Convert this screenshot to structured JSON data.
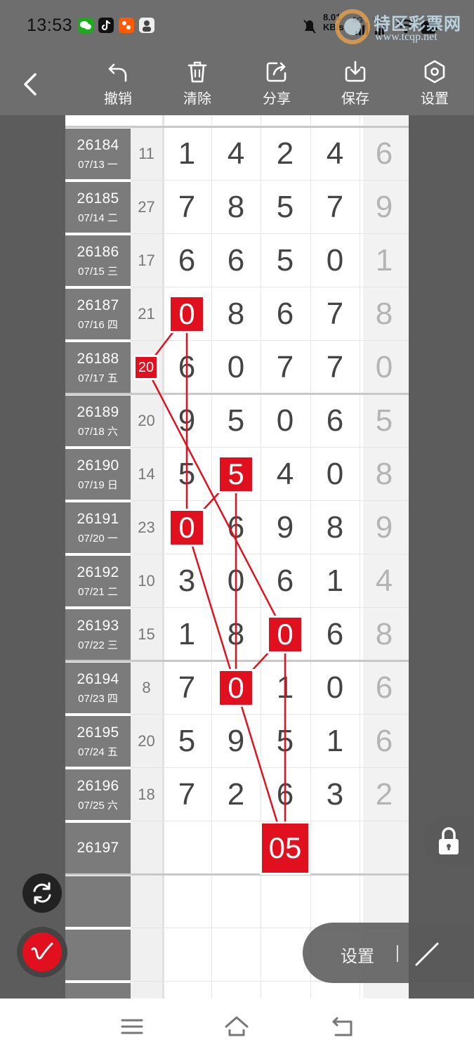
{
  "status_bar": {
    "time": "13:53",
    "speed": "8.01",
    "speed_unit": "KB/s",
    "network_a": "5G",
    "network_b": "5G",
    "icons": [
      "wechat-icon",
      "tiktok-icon",
      "taobao-icon",
      "avatar-app-icon",
      "mute-icon",
      "signal-icon",
      "wifi-icon",
      "battery-icon"
    ]
  },
  "watermark": {
    "title": "特区彩票网",
    "url": "www.tcqp.net"
  },
  "toolbar": {
    "back_icon": "chevron-left-icon",
    "items": [
      {
        "label": "撤销",
        "icon": "undo-icon"
      },
      {
        "label": "清除",
        "icon": "trash-icon"
      },
      {
        "label": "分享",
        "icon": "share-icon"
      },
      {
        "label": "保存",
        "icon": "download-icon"
      },
      {
        "label": "设置",
        "icon": "hexagon-settings-icon"
      }
    ]
  },
  "rows": [
    {
      "issue": "26184",
      "date": "07/13 一",
      "sum": "11",
      "digits": [
        "1",
        "4",
        "2",
        "4",
        "6"
      ]
    },
    {
      "issue": "26185",
      "date": "07/14 二",
      "sum": "27",
      "digits": [
        "7",
        "8",
        "5",
        "7",
        "9"
      ]
    },
    {
      "issue": "26186",
      "date": "07/15 三",
      "sum": "17",
      "digits": [
        "6",
        "6",
        "5",
        "0",
        "1"
      ]
    },
    {
      "issue": "26187",
      "date": "07/16 四",
      "sum": "21",
      "digits": [
        "0",
        "8",
        "6",
        "7",
        "8"
      ]
    },
    {
      "issue": "26188",
      "date": "07/17 五",
      "sum": "20",
      "digits": [
        "6",
        "0",
        "7",
        "7",
        "0"
      ]
    },
    {
      "issue": "26189",
      "date": "07/18 六",
      "sum": "20",
      "digits": [
        "9",
        "5",
        "0",
        "6",
        "5"
      ]
    },
    {
      "issue": "26190",
      "date": "07/19 日",
      "sum": "14",
      "digits": [
        "5",
        "5",
        "4",
        "0",
        "8"
      ]
    },
    {
      "issue": "26191",
      "date": "07/20 一",
      "sum": "23",
      "digits": [
        "0",
        "6",
        "9",
        "8",
        "9"
      ]
    },
    {
      "issue": "26192",
      "date": "07/21 二",
      "sum": "10",
      "digits": [
        "3",
        "0",
        "6",
        "1",
        "4"
      ]
    },
    {
      "issue": "26193",
      "date": "07/22 三",
      "sum": "15",
      "digits": [
        "1",
        "8",
        "0",
        "6",
        "8"
      ]
    },
    {
      "issue": "26194",
      "date": "07/23 四",
      "sum": "8",
      "digits": [
        "7",
        "0",
        "1",
        "0",
        "6"
      ]
    },
    {
      "issue": "26195",
      "date": "07/24 五",
      "sum": "20",
      "digits": [
        "5",
        "9",
        "5",
        "1",
        "6"
      ]
    },
    {
      "issue": "26196",
      "date": "07/25 六",
      "sum": "18",
      "digits": [
        "7",
        "2",
        "6",
        "3",
        "2"
      ]
    }
  ],
  "next_issue": "26197",
  "marks": [
    {
      "text": "0",
      "row": 3,
      "col": 0
    },
    {
      "text": "20",
      "row": 4,
      "col": "sum"
    },
    {
      "text": "5",
      "row": 6,
      "col": 1
    },
    {
      "text": "0",
      "row": 7,
      "col": 0
    },
    {
      "text": "0",
      "row": 9,
      "col": 2
    },
    {
      "text": "0",
      "row": 10,
      "col": 1
    },
    {
      "text": "05",
      "row": 13,
      "col": 2
    }
  ],
  "controls": {
    "lock_icon": "lock-icon",
    "refresh_icon": "refresh-icon",
    "pen_icon": "pen-icon",
    "settings_label": "设置",
    "line_tool_icon": "line-tool-icon"
  },
  "nav_bar": {
    "icons": [
      "menu-icon",
      "home-icon",
      "back-icon"
    ]
  },
  "colors": {
    "accent_red": "#e0101f",
    "toolbar_bg": "#6e6e6e",
    "issue_bg": "#7b7b7b"
  }
}
